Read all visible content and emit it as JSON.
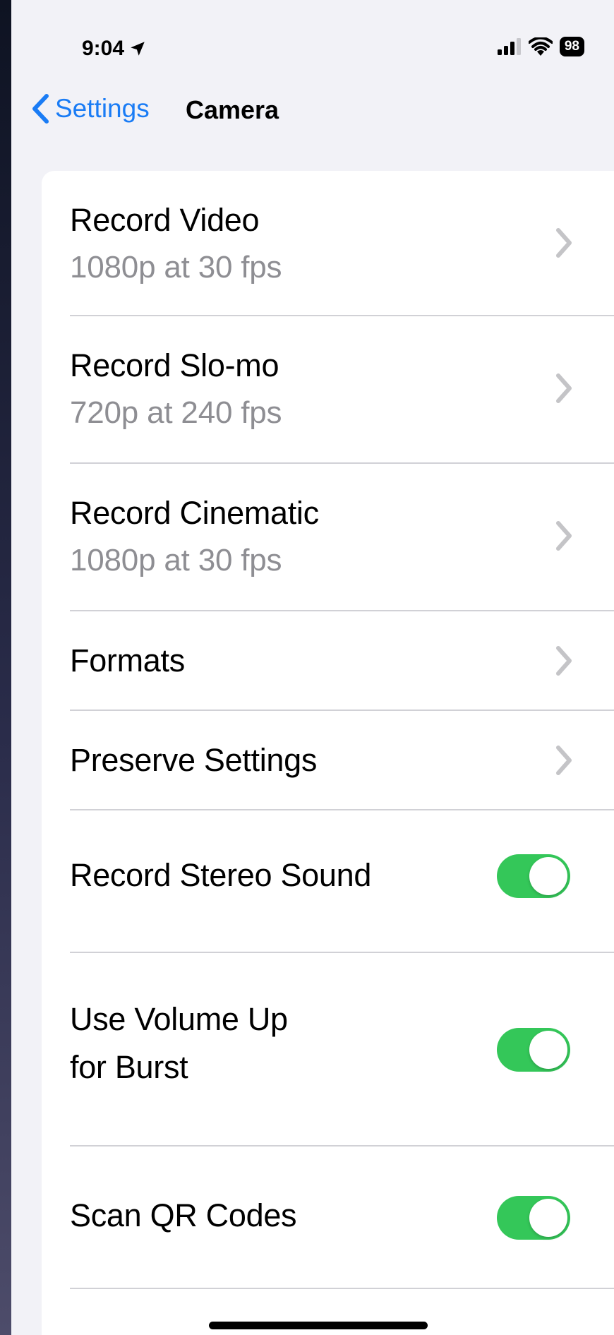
{
  "status_bar": {
    "time": "9:04",
    "battery": "98"
  },
  "nav": {
    "back_label": "Settings",
    "title": "Camera"
  },
  "rows": [
    {
      "label": "Record Video",
      "sub": "1080p at 30 fps"
    },
    {
      "label": "Record Slo-mo",
      "sub": "720p at 240 fps"
    },
    {
      "label": "Record Cinematic",
      "sub": "1080p at 30 fps"
    },
    {
      "label": "Formats"
    },
    {
      "label": "Preserve Settings"
    },
    {
      "label": "Record Stereo Sound",
      "toggle": true
    },
    {
      "label_line1": "Use Volume Up",
      "label_line2": "for Burst",
      "toggle": true
    },
    {
      "label": "Scan QR Codes",
      "toggle": true
    }
  ],
  "colors": {
    "accent": "#1a7cf5",
    "toggle_on": "#34c759",
    "secondary_text": "#8e8e93"
  },
  "icons": [
    "location-arrow-icon",
    "signal-icon",
    "wifi-icon",
    "battery-icon",
    "chevron-left-icon",
    "chevron-right-icon"
  ]
}
